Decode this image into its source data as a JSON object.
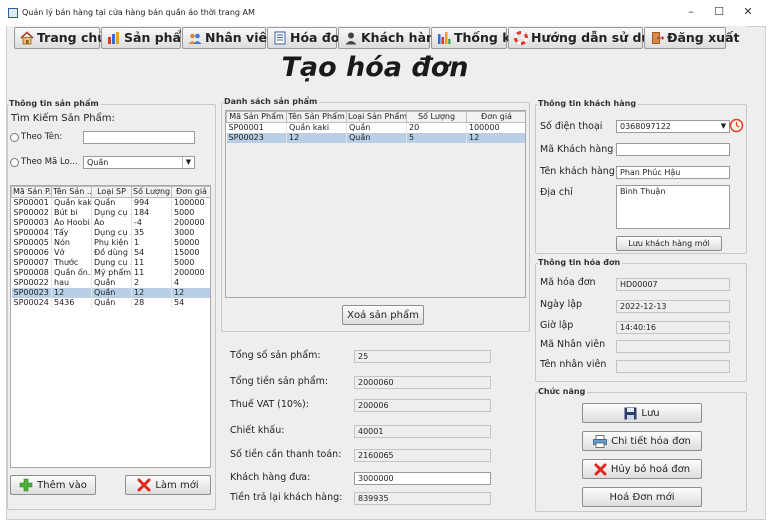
{
  "window": {
    "title": "Quản lý bán hàng tại cửa hàng bán quần áo thời trang AM",
    "minimize": "–",
    "maximize": "☐",
    "close": "✕"
  },
  "menu": [
    {
      "label": "Trang chủ",
      "icon": "home-icon"
    },
    {
      "label": "Sản phẩm",
      "icon": "bar-chart-icon"
    },
    {
      "label": "Nhân viên",
      "icon": "people-icon"
    },
    {
      "label": "Hóa đơn",
      "icon": "invoice-icon"
    },
    {
      "label": "Khách hàng",
      "icon": "user-icon"
    },
    {
      "label": "Thống kê",
      "icon": "stats-icon"
    },
    {
      "label": "Hướng dẫn sử dụng",
      "icon": "lifebuoy-icon"
    },
    {
      "label": "Đăng xuất",
      "icon": "logout-icon"
    }
  ],
  "heading": "Tạo hóa đơn",
  "product_info": {
    "group_label": "Thông tin sản phẩm",
    "search_label": "Tìm Kiếm Sản Phẩm:",
    "by_name_label": "Theo Tên:",
    "by_name_value": "",
    "by_code_label": "Theo Mã Lo...",
    "type_selected": "Quần",
    "columns": [
      "Mã Sản P...",
      "Tên Sản ...",
      "Loại SP",
      "Số Lượng",
      "Đơn giá"
    ],
    "rows": [
      [
        "SP00001",
        "Quần kaki",
        "Quần",
        "994",
        "100000"
      ],
      [
        "SP00002",
        "Bút bi",
        "Dụng cụ ...",
        "184",
        "5000"
      ],
      [
        "SP00003",
        "Áo Hoobi",
        "Áo",
        "-4",
        "200000"
      ],
      [
        "SP00004",
        "Tẩy",
        "Dụng cụ ...",
        "35",
        "3000"
      ],
      [
        "SP00005",
        "Nón",
        "Phụ kiện",
        "1",
        "50000"
      ],
      [
        "SP00006",
        "Vở",
        "Đồ dùng",
        "54",
        "15000"
      ],
      [
        "SP00007",
        "Thước",
        "Dụng cụ ...",
        "11",
        "5000"
      ],
      [
        "SP00008",
        "Quần ốn...",
        "Mỹ phẩm",
        "11",
        "200000"
      ],
      [
        "SP00022",
        "hau",
        "Quần",
        "2",
        "4"
      ],
      [
        "SP00023",
        "12",
        "Quần",
        "12",
        "12"
      ],
      [
        "SP00024",
        "5436",
        "Quần",
        "28",
        "54"
      ]
    ],
    "selected_row": 9,
    "add_button": "Thêm vào",
    "refresh_button": "Làm mới"
  },
  "product_list": {
    "group_label": "Danh sách sản phẩm",
    "columns": [
      "Mã Sản Phẩm",
      "Tên Sản Phẩm",
      "Loại Sản Phẩm",
      "Số Lượng",
      "Đơn giá"
    ],
    "rows": [
      [
        "SP00001",
        "Quần kaki",
        "Quần",
        "20",
        "100000"
      ],
      [
        "SP00023",
        "12",
        "Quần",
        "5",
        "12"
      ]
    ],
    "selected_row": 1,
    "delete_button": "Xoá sản phẩm"
  },
  "summary": [
    {
      "label": "Tổng số sản phẩm:",
      "value": "25"
    },
    {
      "label": "Tổng tiền sản phẩm:",
      "value": "2000060"
    },
    {
      "label": "Thuế VAT (10%):",
      "value": "200006"
    },
    {
      "label": "Chiết khấu:",
      "value": "40001"
    },
    {
      "label": "Số tiền cần thanh toán:",
      "value": "2160065"
    },
    {
      "label": "Khách hàng đưa:",
      "value": "3000000",
      "editable": true
    },
    {
      "label": "Tiền trả lại khách hàng:",
      "value": "839935"
    }
  ],
  "customer": {
    "group_label": "Thông tin khách hàng",
    "phone_label": "Số điện thoại",
    "phone_value": "0368097122",
    "code_label": "Mã Khách hàng",
    "code_value": "",
    "name_label": "Tên khách hàng",
    "name_value": "Phan Phúc Hậu",
    "address_label": "Địa chỉ",
    "address_value": "Bình Thuận",
    "save_new_button": "Lưu khách hàng mới"
  },
  "invoice": {
    "group_label": "Thông tin hóa đơn",
    "fields": [
      {
        "label": "Mã hóa đơn",
        "value": "HD00007"
      },
      {
        "label": "Ngày lập",
        "value": "2022-12-13"
      },
      {
        "label": "Giờ lập",
        "value": "14:40:16"
      },
      {
        "label": "Mã Nhân viên",
        "value": ""
      },
      {
        "label": "Tên nhân viên",
        "value": ""
      }
    ]
  },
  "functions": {
    "group_label": "Chức năng",
    "save": "Lưu",
    "detail": "Chi tiết hóa đơn",
    "cancel": "Hủy bỏ hoá đơn",
    "new": "Hoá Đơn mới"
  }
}
